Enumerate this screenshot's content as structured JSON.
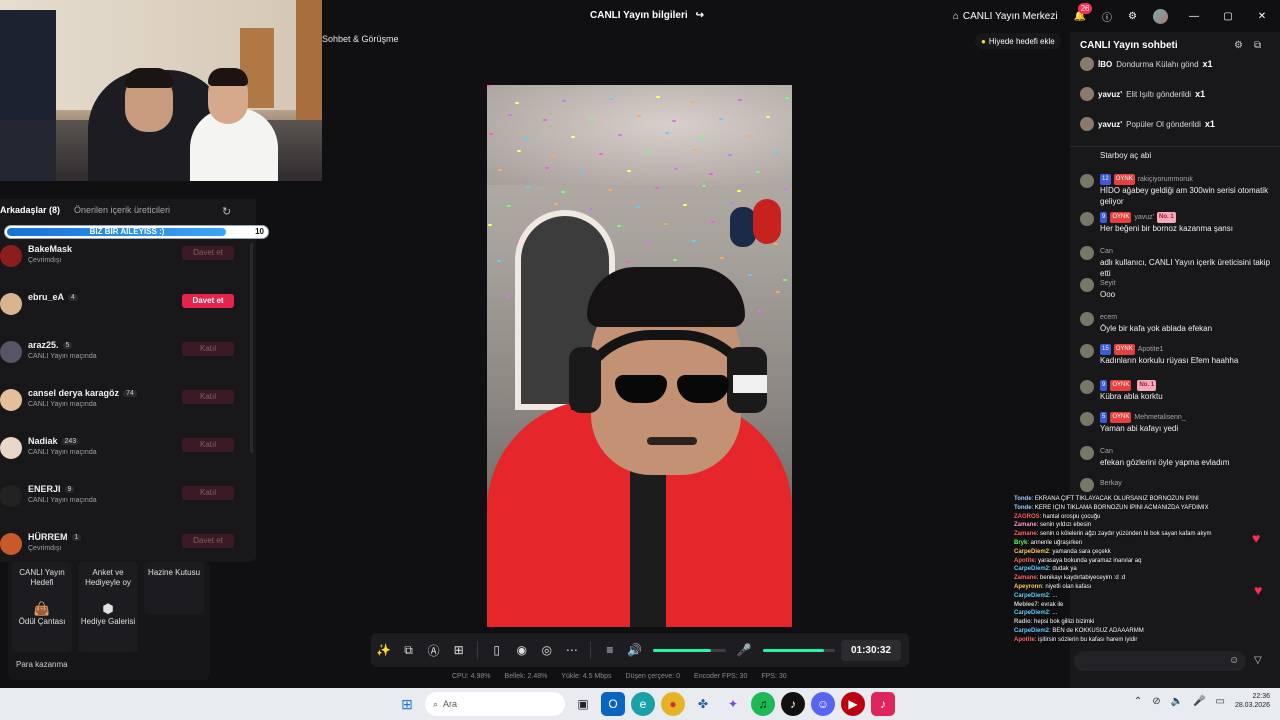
{
  "topbar": {
    "stream_info": "CANLI Yayın bilgileri",
    "live_center": "CANLI Yayın Merkezi",
    "notif_count": "26"
  },
  "cam_label": "Sohbet & Görüşme",
  "gift_goal_button": "Hiyede hedefi ekle",
  "friends": {
    "tab_friends": "Arkadaşlar (8)",
    "tab_suggested": "Önerilen içerik üreticileri",
    "progress_text": "BIZ BIR AILEYISS :)",
    "progress_value": "10",
    "progress_fraction": 0.92,
    "items": [
      {
        "name": "BakeMask",
        "count": "",
        "status": "Çevrimdışı",
        "button": "Davet et",
        "active": false
      },
      {
        "name": "ebru_eA",
        "count": "4",
        "status": "",
        "button": "Davet et",
        "active": true
      },
      {
        "name": "araz25.",
        "count": "5",
        "status": "CANLI Yayın maçında",
        "button": "Katıl",
        "active": false
      },
      {
        "name": "cansel derya karagöz",
        "count": "74",
        "status": "CANLI Yayın maçında",
        "button": "Katıl",
        "active": false
      },
      {
        "name": "Nadiak",
        "count": "243",
        "status": "CANLI Yayın maçında",
        "button": "Katıl",
        "active": false
      },
      {
        "name": "ENERJI",
        "count": "9",
        "status": "CANLI Yayın maçında",
        "button": "Katıl",
        "active": false
      },
      {
        "name": "HÜRREM",
        "count": "1",
        "status": "Çevrimdışı",
        "button": "Davet et",
        "active": false
      }
    ]
  },
  "tiles": {
    "live_goal": "CANLI Yayın Hedefi",
    "poll": "Anket ve Hediyeyle oy",
    "treasure": "Hazine Kutusu",
    "reward_bag": "Ödül Çantası",
    "gift_gallery": "Hediye Galerisi",
    "earn": "Para kazanma"
  },
  "controls": {
    "timer": "01:30:32",
    "volume_level": 0.8,
    "mic_level": 0.85
  },
  "stats": {
    "cpu": "CPU: 4.98%",
    "memory": "Bellek: 2.48%",
    "upload": "Yükle: 4.5 Mbps",
    "dropped": "Düşen çerçeve: 0",
    "encoder": "Encoder FPS: 30",
    "fps": "FPS: 30"
  },
  "chat": {
    "title": "CANLI Yayın sohbeti",
    "gifts": [
      {
        "user": "İBO",
        "text": "Dondurma Külahı gönd",
        "mult": "x1"
      },
      {
        "user": "yavuz'",
        "text": "Elit Işıltı gönderildi",
        "mult": "x1"
      },
      {
        "user": "yavuz'",
        "text": "Popüler Ol gönderildi",
        "mult": "x1"
      }
    ],
    "messages": [
      {
        "user": "",
        "lvl": "",
        "text": "Starboy aç abi",
        "badges": false
      },
      {
        "user": "rakiçiyorummoruk",
        "lvl": "12",
        "text": "HİDO ağabey geldiği am 300win serisi otomatik geliyor",
        "badges": true
      },
      {
        "user": "yavuz'",
        "lvl": "9",
        "text": "Her beğeni bir bornoz kazanma şansı",
        "badges": true,
        "no1": "No. 1"
      },
      {
        "user": "Can",
        "lvl": "",
        "text": "adlı kullanıcı, CANLI Yayın içerik üreticisini takip etti",
        "badges": false
      },
      {
        "user": "Seyit",
        "lvl": "",
        "text": "Ooo",
        "badges": false
      },
      {
        "user": "ecem",
        "lvl": "",
        "text": "Öyle bir kafa yok ablada efekan",
        "badges": false
      },
      {
        "user": "Apotite1",
        "lvl": "15",
        "text": "Kadınların korkulu rüyası Efem haahha",
        "badges": true
      },
      {
        "user": "",
        "lvl": "9",
        "text": "Kübra abla korktu",
        "badges": true,
        "no1": "No. 1"
      },
      {
        "user": "Mehmetalisenn_",
        "lvl": "5",
        "text": "Yaman abi kafayı yedi",
        "badges": true
      },
      {
        "user": "Can",
        "lvl": "",
        "text": "efekan gözlerini öyle yapma evladım",
        "badges": false
      },
      {
        "user": "Berkay",
        "lvl": "",
        "text": "",
        "badges": false
      }
    ],
    "badge_oynk": "OYNK"
  },
  "overlay_lines": [
    {
      "n": "Tonde",
      "t": ": EKRANA ÇİFT TIKLAYACAK OLURSANIZ BORNOZUN İPİNİ"
    },
    {
      "n": "Tonde",
      "t": ": KERE İÇİN TIKLAMA BORNOZUN İPİNİ ACMANIZDA YAFDIMIX"
    },
    {
      "n": "ZAGROS",
      "t": ": hantal orospu çocuğu"
    },
    {
      "n": "Zamane",
      "t": ": senin yıldızı ebesin"
    },
    {
      "n": "Zamane",
      "t": ": senin o kölelerin ağzı zaydır yüzünden bi bok sayan kafam akym"
    },
    {
      "n": "Bryk",
      "t": ": annenle uğraşırken"
    },
    {
      "n": "CarpeDiem2",
      "t": ": yamanda sara çeçekk"
    },
    {
      "n": "Apotite",
      "t": ": yarasaya bokunda yaramaz inanılar aq"
    },
    {
      "n": "CarpeDiem2",
      "t": ": dudak ya"
    },
    {
      "n": "Zamane",
      "t": ": benikayı kaydırtabiyeceyim :d :d"
    },
    {
      "n": "Apeyronn",
      "t": ": niyetli olan kafası"
    },
    {
      "n": "CarpeDiem2",
      "t": ": ..."
    },
    {
      "n": "Meblee7",
      "t": ": evrak ile"
    },
    {
      "n": "CarpeDiem2",
      "t": ": ..."
    },
    {
      "n": "Radio",
      "t": ": hepsi bok gillizi bizimki"
    },
    {
      "n": "CarpeDiem2",
      "t": ": BEN de KOKKUSUZ ADAAARMM"
    },
    {
      "n": "Apotite",
      "t": ": işitirsin sözlerin bu kafası harem iyidir"
    }
  ],
  "taskbar": {
    "search": "Ara",
    "time": "22:36",
    "date": "28.03.2026"
  }
}
